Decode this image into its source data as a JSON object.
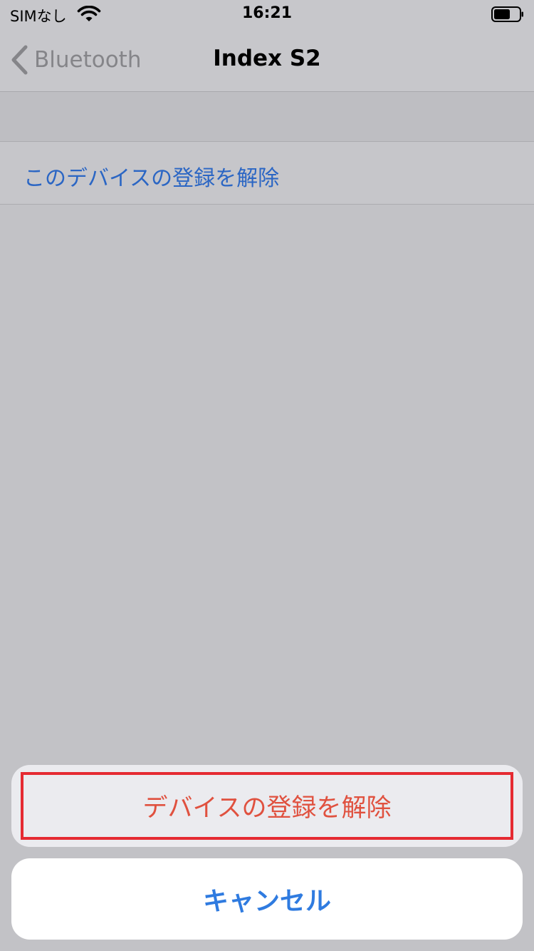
{
  "status_bar": {
    "carrier": "SIMなし",
    "time": "16:21",
    "wifi_icon": "wifi-icon",
    "battery_icon": "battery-icon"
  },
  "nav": {
    "back_label": "Bluetooth",
    "back_icon": "chevron-left-icon",
    "title": "Index S2"
  },
  "settings": {
    "forget_device_label": "このデバイスの登録を解除"
  },
  "action_sheet": {
    "destructive_label": "デバイスの登録を解除",
    "cancel_label": "キャンセル"
  },
  "colors": {
    "link_blue": "#2b66c4",
    "destructive_red": "#e0513f",
    "highlight_border": "#e52a32",
    "cancel_blue": "#2f7be0"
  }
}
